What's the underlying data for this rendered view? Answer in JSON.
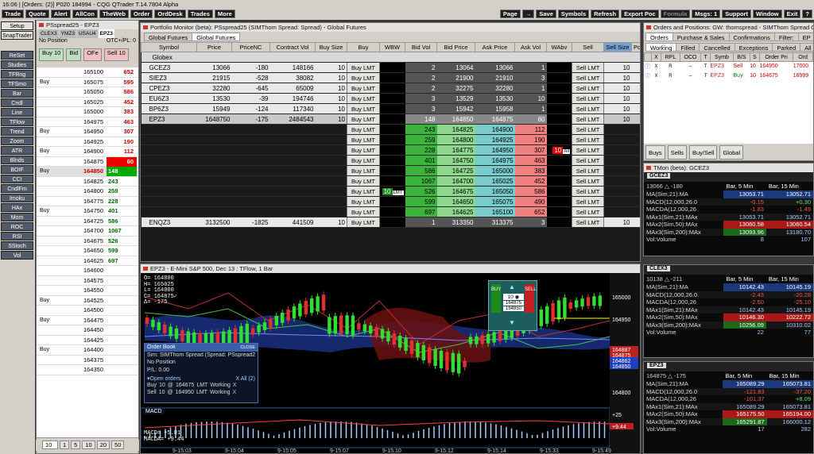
{
  "app": {
    "clock": "16:06",
    "orders": "[Orders: (2)]",
    "account": "P020",
    "id": "184994",
    "title": "CQG QTrader T.14.7804 Alpha",
    "left_menu": [
      "Trade",
      "Quote",
      "Alert",
      "AllCon",
      "TheWeb",
      "Order",
      "OrdDesk",
      "Trades",
      "More"
    ],
    "right_menu": [
      "Page",
      "→",
      "Save",
      "Symbols",
      "Refresh",
      "Export Poc",
      "Formula",
      "Msgs: 1",
      "Support",
      "Window",
      "Exit"
    ],
    "help": "?"
  },
  "sidebar": [
    "Setup",
    "SnapTrader",
    "ReSet",
    "Studies",
    "TFRng",
    "TFSmo",
    "Bar",
    "Cndl",
    "Line",
    "TFlow",
    "Trend",
    "Zoom",
    "ATR",
    "Blnds",
    "BOIF",
    "CCI",
    "CndlFm",
    "Imoku",
    "HAx",
    "Mom",
    "ROC",
    "RSI",
    "SStoch",
    "Vol"
  ],
  "dom": {
    "title": "PSspread25 - EPZ3",
    "tabs": [
      "CLEX3",
      "YMZ3",
      "USAU4",
      "EPZ3"
    ],
    "position": "No Position",
    "otc": "OTC+/PL: 0",
    "buy": "Buy 10",
    "sell": "Sell 10",
    "ofs": "OFe",
    "mid": "Bid",
    "rows": [
      {
        "p": "165100",
        "s": "652",
        "b": "",
        "l": ""
      },
      {
        "p": "165075",
        "s": "595",
        "b": "",
        "l": "Buy"
      },
      {
        "p": "165050",
        "s": "586",
        "b": "",
        "l": ""
      },
      {
        "p": "165025",
        "s": "452",
        "b": "",
        "l": ""
      },
      {
        "p": "165000",
        "s": "383",
        "b": "",
        "l": ""
      },
      {
        "p": "164975",
        "s": "463",
        "b": "",
        "l": ""
      },
      {
        "p": "164950",
        "s": "307",
        "b": "",
        "l": "Buy"
      },
      {
        "p": "164925",
        "s": "190",
        "b": "",
        "l": ""
      },
      {
        "p": "164900",
        "s": "112",
        "b": "",
        "l": "Buy"
      },
      {
        "p": "164875",
        "s": "60",
        "b": "",
        "l": ""
      },
      {
        "p": "164850",
        "s": "",
        "b": "148",
        "l": "Buy"
      },
      {
        "p": "164825",
        "s": "",
        "b": "243",
        "l": ""
      },
      {
        "p": "164800",
        "s": "",
        "b": "259",
        "l": ""
      },
      {
        "p": "164775",
        "s": "",
        "b": "228",
        "l": ""
      },
      {
        "p": "164750",
        "s": "",
        "b": "401",
        "l": "Buy"
      },
      {
        "p": "164725",
        "s": "",
        "b": "586",
        "l": ""
      },
      {
        "p": "164700",
        "s": "",
        "b": "1067",
        "l": ""
      },
      {
        "p": "164675",
        "s": "",
        "b": "526",
        "l": ""
      },
      {
        "p": "164650",
        "s": "",
        "b": "599",
        "l": ""
      },
      {
        "p": "164625",
        "s": "",
        "b": "697",
        "l": ""
      },
      {
        "p": "164600",
        "s": "",
        "b": "",
        "l": ""
      },
      {
        "p": "164575",
        "s": "",
        "b": "",
        "l": ""
      },
      {
        "p": "164550",
        "s": "",
        "b": "",
        "l": ""
      },
      {
        "p": "164525",
        "s": "",
        "b": "",
        "l": "Buy"
      },
      {
        "p": "164500",
        "s": "",
        "b": "",
        "l": ""
      },
      {
        "p": "164475",
        "s": "",
        "b": "",
        "l": "Buy"
      },
      {
        "p": "164450",
        "s": "",
        "b": "",
        "l": ""
      },
      {
        "p": "164425",
        "s": "",
        "b": "",
        "l": ""
      },
      {
        "p": "164400",
        "s": "",
        "b": "",
        "l": "Buy"
      },
      {
        "p": "164375",
        "s": "",
        "b": "",
        "l": ""
      },
      {
        "p": "164350",
        "s": "",
        "b": "",
        "l": ""
      }
    ],
    "qty": [
      "10",
      "1",
      "5",
      "10",
      "20",
      "50"
    ],
    "footer": [
      "Buy",
      "Go",
      "Sell"
    ]
  },
  "pm": {
    "title": "Portfolio Monitor (beta): PSspread25 (SIMThom Spread: Spread) - Global Futures",
    "tabs": [
      "Global Futures",
      "Global Futures"
    ],
    "cols": [
      "Symbol",
      "Price",
      "PriceNC",
      "Contract Vol",
      "Buy Size",
      "Buy",
      "WBW",
      "Bid Vol",
      "Bid Price",
      "Ask Price",
      "Ask Vol",
      "WAbv",
      "Sell",
      "Sell Size",
      "Po"
    ],
    "group": "Globex",
    "rows": [
      {
        "s": "GCEZ3",
        "p": "13066",
        "nc": "-180",
        "cv": "148166",
        "bs": "10",
        "bv": "2",
        "bp": "13064",
        "ap": "13066",
        "av": "1",
        "ss": "10"
      },
      {
        "s": "SIEZ3",
        "p": "21915",
        "nc": "-528",
        "cv": "38082",
        "bs": "10",
        "bv": "2",
        "bp": "21900",
        "ap": "21910",
        "av": "3",
        "ss": "10"
      },
      {
        "s": "CPEZ3",
        "p": "32280",
        "nc": "-645",
        "cv": "65009",
        "bs": "10",
        "bv": "2",
        "bp": "32275",
        "ap": "32280",
        "av": "1",
        "ss": "10"
      },
      {
        "s": "EU6Z3",
        "p": "13530",
        "nc": "-39",
        "cv": "194746",
        "bs": "10",
        "bv": "3",
        "bp": "13529",
        "ap": "13530",
        "av": "10",
        "ss": "10"
      },
      {
        "s": "BP6Z3",
        "p": "15949",
        "nc": "-124",
        "cv": "117340",
        "bs": "10",
        "bv": "3",
        "bp": "15942",
        "ap": "15958",
        "av": "1",
        "ss": "10"
      },
      {
        "s": "EPZ3",
        "p": "1648750",
        "nc": "-175",
        "cv": "2484543",
        "bs": "10",
        "bv": "148",
        "bp": "164850",
        "ap": "164875",
        "av": "60",
        "ss": "10"
      }
    ],
    "ladder": [
      {
        "bv": "243",
        "bp": "164825",
        "ap": "164900",
        "av": "112"
      },
      {
        "bv": "259",
        "bp": "164800",
        "ap": "164925",
        "av": "190"
      },
      {
        "bv": "228",
        "bp": "164775",
        "ap": "164950",
        "av": "307"
      },
      {
        "bv": "401",
        "bp": "164750",
        "ap": "164975",
        "av": "463"
      },
      {
        "bv": "586",
        "bp": "164725",
        "ap": "165000",
        "av": "383"
      },
      {
        "bv": "1067",
        "bp": "164700",
        "ap": "165025",
        "av": "452"
      },
      {
        "bv": "526",
        "bp": "164675",
        "ap": "165050",
        "av": "586"
      },
      {
        "bv": "599",
        "bp": "164650",
        "ap": "165075",
        "av": "490"
      },
      {
        "bv": "697",
        "bp": "164625",
        "ap": "165100",
        "av": "652"
      }
    ],
    "enq": {
      "s": "ENQZ3",
      "p": "3132500",
      "nc": "-1825",
      "cv": "441509",
      "bs": "10",
      "bv": "1",
      "bp": "313350",
      "ap": "313375",
      "av": "3",
      "ss": "10"
    },
    "buy_lmt": "Buy LMT",
    "sell_lmt": "Sell LMT",
    "wbw_qty": "10",
    "lmt": "LMT",
    "wabv_qty": "10",
    "all": "All",
    "dash": "- -"
  },
  "chart": {
    "title": "EPZ3 - E-Mini S&P 500, Dec 13 : TFlow, 1 Bar",
    "info": [
      "O= 164800",
      "H= 165025",
      "L= 164000",
      "C= 164875✓",
      "Δ= -175"
    ],
    "price_axis": [
      "165000",
      "164950",
      "164887",
      "164875",
      "164862",
      "164850",
      "164800"
    ],
    "times": [
      "9-15:03",
      "9-15:04",
      "9-15:05",
      "9-15:07",
      "9-15:10",
      "9-15:12",
      "9-15:14",
      "9-15:33",
      "9-15:49"
    ],
    "macd_label": "MACD",
    "macd_vals": [
      "MACD= +5.81",
      "MACDA= +9.44"
    ],
    "macd_axis": [
      "+25",
      "+9.44"
    ],
    "ob": {
      "title": "Order Book",
      "close": "CLOSE",
      "account": "Sim: SIMThom Spread (Spread: PSspread25)",
      "pos": "No Position",
      "pl": "P/L: 0.00",
      "open": "▾Open orders",
      "xall": "X All (2)",
      "orders": [
        {
          "side": "Buy",
          "qty": "10",
          "at": "@",
          "price": "164675",
          "type": "LMT",
          "st": "Working",
          "x": "X"
        },
        {
          "side": "Sell",
          "qty": "10",
          "at": "@",
          "price": "164950",
          "type": "LMT",
          "st": "Working",
          "x": "X"
        }
      ]
    },
    "trade": {
      "buy": "BUY",
      "sell": "SELL",
      "qty": "10 ◉",
      "p1": "164875",
      "p2": "164850"
    }
  },
  "orders": {
    "title": "Orders and Positions: GW: thomspread - SIMThom Spread OTE+/PL: 0.00",
    "tabs1": [
      "Orders",
      "Purchase & Sales",
      "Confirmations",
      "Filter:",
      "EP"
    ],
    "tabs2": [
      "Working",
      "Filled",
      "Cancelled",
      "Exceptions",
      "Parked",
      "All"
    ],
    "cols": [
      "",
      "X",
      "RPL",
      "OCO",
      "T",
      "Symb",
      "B/S",
      "S",
      "Order Pri",
      "Ord"
    ],
    "rows": [
      {
        "sym": "EPZ3",
        "bs": "Sell",
        "s": "10",
        "pr": "164950",
        "ord": "17000"
      },
      {
        "sym": "EPZ3",
        "bs": "Buy",
        "s": "10",
        "pr": "164675",
        "ord": "16999"
      }
    ],
    "footer": [
      "Buys",
      "Sells",
      "Buy/Sell",
      "Global"
    ]
  },
  "tmons": [
    {
      "title": "TMon (beta): GCEZ3",
      "sym": "GCEZ3",
      "q": "13066 △ -180",
      "c1": "Bar, 5 Min",
      "c2": "Bar, 15 Min",
      "rows": [
        [
          "MA(Sim,21):MA",
          "13053.71",
          "13052.71"
        ],
        [
          "MACD(12,000,26.0",
          "-0.15",
          "+0.30"
        ],
        [
          "MACDA(12,000,26",
          "-1.83",
          "-1.49"
        ],
        [
          "MAx1(Sim,21):MAx",
          "13053.71",
          "13052.71"
        ],
        [
          "MAx2(Sim,50):MAx",
          "13060.58",
          "13060.54"
        ],
        [
          "MAx3(Sim,200):MAx",
          "13093.96",
          "13180.70"
        ],
        [
          "Vol:Volume",
          "8",
          "107"
        ]
      ]
    },
    {
      "title": "",
      "sym": "CLEX3",
      "q": "10138 △ -211",
      "c1": "Bar, 5 Min",
      "c2": "Bar, 15 Min",
      "rows": [
        [
          "MA(Sim,21):MA",
          "10142.43",
          "10145.19"
        ],
        [
          "MACD(12,000,26.0",
          "-2.43",
          "-20.28"
        ],
        [
          "MACDA(12,000,26",
          "-2.50",
          "-25.10"
        ],
        [
          "MAx1(Sim,21):MAx",
          "10142.43",
          "10145.19"
        ],
        [
          "MAx2(Sim,50):MAx",
          "10146.30",
          "10222.72"
        ],
        [
          "MAx3(Sim,200):MAx",
          "10256.09",
          "10310.02"
        ],
        [
          "Vol:Volume",
          "22",
          "77"
        ]
      ]
    },
    {
      "title": "",
      "sym": "EPZ3",
      "q": "164875 △ -175",
      "c1": "Bar, 5 Min",
      "c2": "Bar, 15 Min",
      "rows": [
        [
          "MA(Sim,21):MA",
          "165089.29",
          "165073.81"
        ],
        [
          "MACD(12,000,26.0",
          "-121.83",
          "-37.20"
        ],
        [
          "MACDA(12,000,26",
          "-101.37",
          "+8.09"
        ],
        [
          "MAx1(Sim,21):MAx",
          "165089.29",
          "165073.81"
        ],
        [
          "MAx2(Sim,50):MAx",
          "165175.50",
          "165194.00"
        ],
        [
          "MAx3(Sim,200):MAx",
          "165291.87",
          "166000.12"
        ],
        [
          "Vol:Volume",
          "17",
          "282"
        ]
      ]
    }
  ]
}
